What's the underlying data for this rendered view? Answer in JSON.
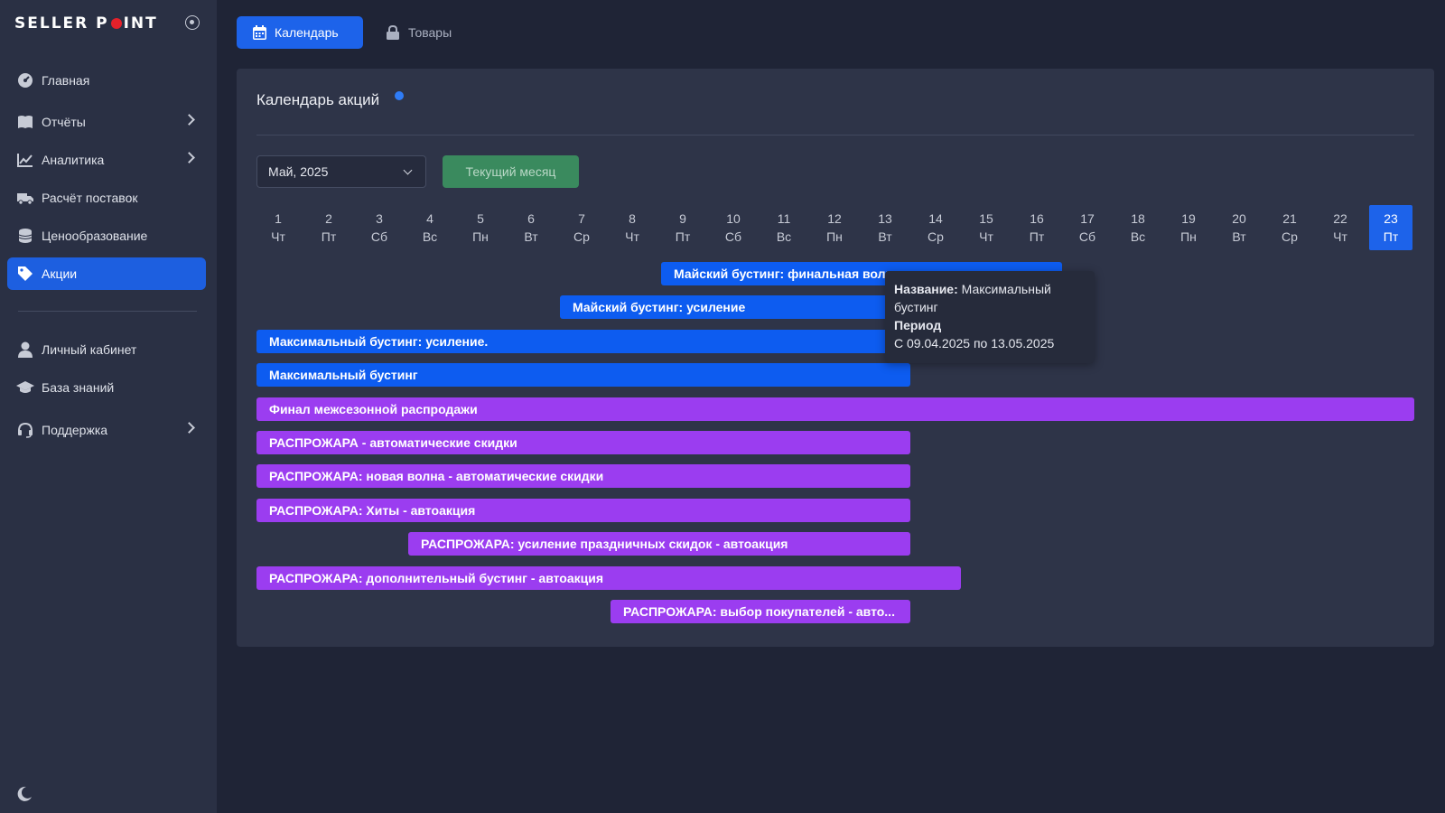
{
  "sidebar": {
    "logo_left": "SELLER P",
    "logo_right": "INT",
    "items": [
      {
        "label": "Главная",
        "icon": "dashboard-icon"
      },
      {
        "label": "Отчёты",
        "icon": "book-icon"
      },
      {
        "label": "Аналитика",
        "icon": "chart-line-icon"
      },
      {
        "label": "Расчёт поставок",
        "icon": "truck-icon"
      },
      {
        "label": "Ценообразование",
        "icon": "coins-icon"
      },
      {
        "label": "Акции",
        "icon": "tags-icon"
      },
      {
        "label": "Личный кабинет",
        "icon": "user-icon"
      },
      {
        "label": "База знаний",
        "icon": "graduation-cap-icon"
      },
      {
        "label": "Поддержка",
        "icon": "headset-icon"
      }
    ]
  },
  "tabs": [
    {
      "label": "Календарь",
      "icon": "calendar-icon",
      "active": true
    },
    {
      "label": "Товары",
      "icon": "lock-icon",
      "active": false
    }
  ],
  "card": {
    "title": "Календарь акций",
    "month_select": "Май, 2025",
    "current_month_button": "Текущий месяц"
  },
  "days": [
    {
      "d": "1",
      "w": "Чт"
    },
    {
      "d": "2",
      "w": "Пт"
    },
    {
      "d": "3",
      "w": "Сб"
    },
    {
      "d": "4",
      "w": "Вс"
    },
    {
      "d": "5",
      "w": "Пн"
    },
    {
      "d": "6",
      "w": "Вт"
    },
    {
      "d": "7",
      "w": "Ср"
    },
    {
      "d": "8",
      "w": "Чт"
    },
    {
      "d": "9",
      "w": "Пт"
    },
    {
      "d": "10",
      "w": "Сб"
    },
    {
      "d": "11",
      "w": "Вс"
    },
    {
      "d": "12",
      "w": "Пн"
    },
    {
      "d": "13",
      "w": "Вт"
    },
    {
      "d": "14",
      "w": "Ср"
    },
    {
      "d": "15",
      "w": "Чт"
    },
    {
      "d": "16",
      "w": "Пт"
    },
    {
      "d": "17",
      "w": "Сб"
    },
    {
      "d": "18",
      "w": "Вс"
    },
    {
      "d": "19",
      "w": "Пн"
    },
    {
      "d": "20",
      "w": "Вт"
    },
    {
      "d": "21",
      "w": "Ср"
    },
    {
      "d": "22",
      "w": "Чт"
    },
    {
      "d": "23",
      "w": "Пт"
    }
  ],
  "today": "23",
  "promotions": [
    {
      "label": "Майский бустинг: финальная волна",
      "color": "#0d5cf0"
    },
    {
      "label": "Майский бустинг: усиление",
      "color": "#0d5cf0"
    },
    {
      "label": "Максимальный бустинг: усиление.",
      "color": "#0d5cf0"
    },
    {
      "label": "Максимальный бустинг",
      "color": "#0d5cf0"
    },
    {
      "label": "Финал межсезонной распродажи",
      "color": "#9b3df0"
    },
    {
      "label": "РАСПРОЖАРА - автоматические скидки",
      "color": "#9b3df0"
    },
    {
      "label": "РАСПРОЖАРА: новая волна - автоматические скидки",
      "color": "#9b3df0"
    },
    {
      "label": "РАСПРОЖАРА: Хиты - автоакция",
      "color": "#9b3df0"
    },
    {
      "label": "РАСПРОЖАРА: усиление праздничных скидок - автоакция",
      "color": "#9b3df0"
    },
    {
      "label": "РАСПРОЖАРА: дополнительный бустинг - автоакция",
      "color": "#9b3df0"
    },
    {
      "label": "РАСПРОЖАРА: выбор покупателей - авто...",
      "color": "#9b3df0"
    }
  ],
  "tooltip": {
    "name_label": "Название:",
    "name_value": "Максимальный бустинг",
    "period_label": "Период",
    "period_value": "С 09.04.2025 по 13.05.2025"
  }
}
